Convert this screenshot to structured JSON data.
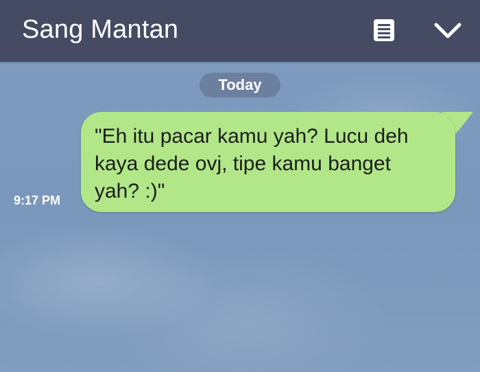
{
  "header": {
    "title": "Sang Mantan",
    "notes_icon": "notes-icon",
    "menu_icon": "chevron-down-icon"
  },
  "chat": {
    "date_separator": "Today",
    "messages": [
      {
        "direction": "outgoing",
        "text": "\"Eh itu pacar kamu yah? Lucu deh\nkaya dede ovj, tipe kamu banget\nyah? :)\"",
        "time": "9:17 PM"
      }
    ]
  },
  "colors": {
    "header_bg": "#454b62",
    "chat_bg": "#7d9bbe",
    "bubble_bg": "#b1e788",
    "date_pill_bg": "#6b7f9e"
  }
}
